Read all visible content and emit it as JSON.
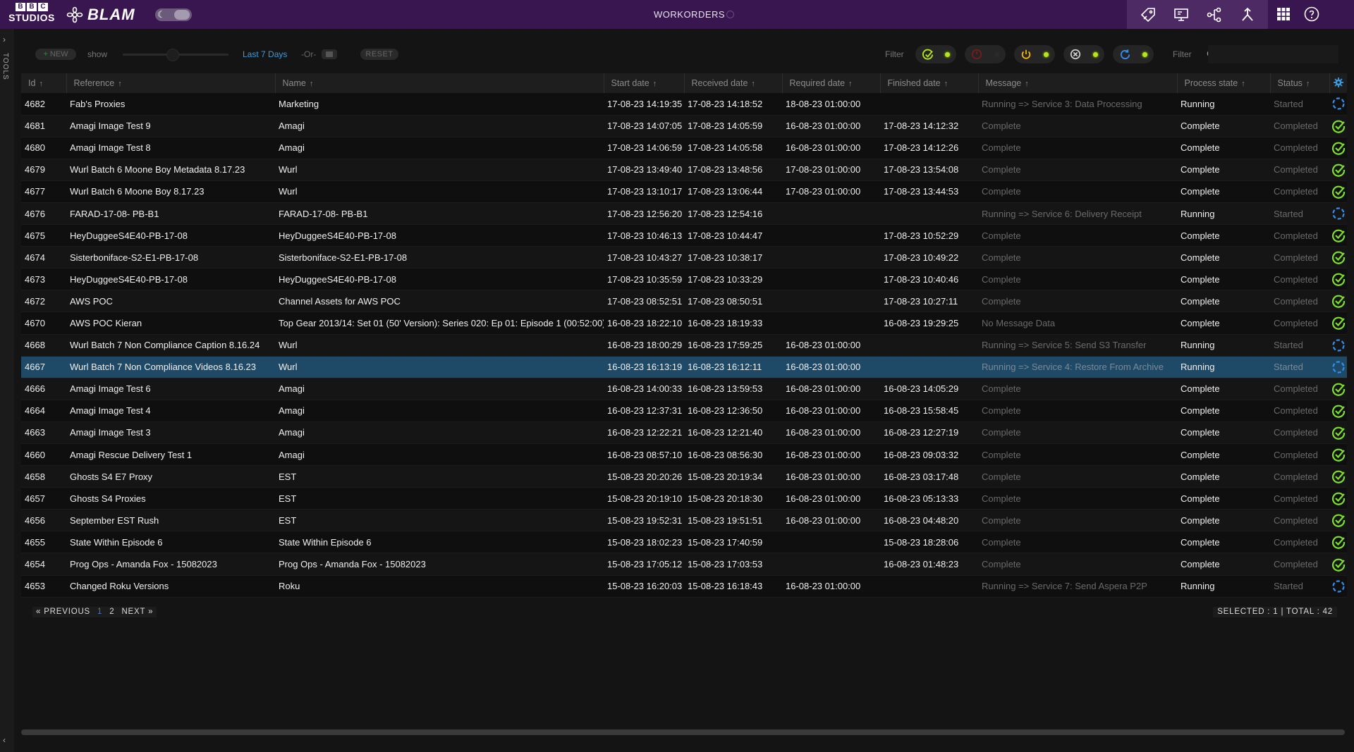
{
  "app": {
    "logo_top": [
      "B",
      "B",
      "C"
    ],
    "logo_bottom": "STUDIOS",
    "brand": "BLAM",
    "title": "WORKORDERS"
  },
  "tools": {
    "label": "TOOLS"
  },
  "filterbar": {
    "new_label": "NEW",
    "show_label": "show",
    "range_label": "Last 7 Days",
    "or_label": "-Or-",
    "reset_label": "RESET",
    "filter_label": "Filter",
    "search_label": "Filter",
    "search_value": "",
    "pills": [
      {
        "icon": "check-circle-icon",
        "color": "#b5e61d",
        "active": true
      },
      {
        "icon": "stop-circle-icon",
        "color": "#7a1b1b",
        "active": false
      },
      {
        "icon": "power-icon",
        "color": "#f5b800",
        "active": true
      },
      {
        "icon": "cancel-circle-icon",
        "color": "#cfcfcf",
        "active": true
      },
      {
        "icon": "refresh-icon",
        "color": "#2f8ff0",
        "active": true
      }
    ]
  },
  "table": {
    "columns": [
      {
        "label": "Id",
        "arrow": "↑"
      },
      {
        "label": "Reference",
        "arrow": "↑"
      },
      {
        "label": "Name",
        "arrow": "↑"
      },
      {
        "label": "Start date",
        "arrow": "↑"
      },
      {
        "label": "Received date",
        "arrow": "↑"
      },
      {
        "label": "Required date",
        "arrow": "↑"
      },
      {
        "label": "Finished date",
        "arrow": "↑"
      },
      {
        "label": "Message",
        "arrow": "↑"
      },
      {
        "label": "Process state",
        "arrow": "↑"
      },
      {
        "label": "Status",
        "arrow": "↑"
      }
    ],
    "rows": [
      {
        "id": "4682",
        "reference": "Fab's Proxies",
        "name": "Marketing",
        "start": "17-08-23 14:19:35",
        "received": "17-08-23 14:18:52",
        "required": "18-08-23 01:00:00",
        "finished": "",
        "message": "Running => Service 3: Data Processing",
        "process": "Running",
        "status": "Started",
        "icon": "spinner-icon"
      },
      {
        "id": "4681",
        "reference": "Amagi Image Test 9",
        "name": "Amagi",
        "start": "17-08-23 14:07:05",
        "received": "17-08-23 14:05:59",
        "required": "16-08-23 01:00:00",
        "finished": "17-08-23 14:12:32",
        "message": "Complete",
        "process": "Complete",
        "status": "Completed",
        "icon": "check-icon"
      },
      {
        "id": "4680",
        "reference": "Amagi Image Test 8",
        "name": "Amagi",
        "start": "17-08-23 14:06:59",
        "received": "17-08-23 14:05:58",
        "required": "16-08-23 01:00:00",
        "finished": "17-08-23 14:12:26",
        "message": "Complete",
        "process": "Complete",
        "status": "Completed",
        "icon": "check-icon"
      },
      {
        "id": "4679",
        "reference": "Wurl Batch 6 Moone Boy Metadata 8.17.23",
        "name": "Wurl",
        "start": "17-08-23 13:49:40",
        "received": "17-08-23 13:48:56",
        "required": "17-08-23 01:00:00",
        "finished": "17-08-23 13:54:08",
        "message": "Complete",
        "process": "Complete",
        "status": "Completed",
        "icon": "check-icon"
      },
      {
        "id": "4677",
        "reference": "Wurl Batch 6 Moone Boy 8.17.23",
        "name": "Wurl",
        "start": "17-08-23 13:10:17",
        "received": "17-08-23 13:06:44",
        "required": "17-08-23 01:00:00",
        "finished": "17-08-23 13:44:53",
        "message": "Complete",
        "process": "Complete",
        "status": "Completed",
        "icon": "check-icon"
      },
      {
        "id": "4676",
        "reference": "FARAD-17-08- PB-B1",
        "name": "FARAD-17-08- PB-B1",
        "start": "17-08-23 12:56:20",
        "received": "17-08-23 12:54:16",
        "required": "",
        "finished": "",
        "message": "Running => Service 6: Delivery Receipt",
        "process": "Running",
        "status": "Started",
        "icon": "spinner-icon"
      },
      {
        "id": "4675",
        "reference": "HeyDuggeeS4E40-PB-17-08",
        "name": "HeyDuggeeS4E40-PB-17-08",
        "start": "17-08-23 10:46:13",
        "received": "17-08-23 10:44:47",
        "required": "",
        "finished": "17-08-23 10:52:29",
        "message": "Complete",
        "process": "Complete",
        "status": "Completed",
        "icon": "check-icon"
      },
      {
        "id": "4674",
        "reference": "Sisterboniface-S2-E1-PB-17-08",
        "name": "Sisterboniface-S2-E1-PB-17-08",
        "start": "17-08-23 10:43:27",
        "received": "17-08-23 10:38:17",
        "required": "",
        "finished": "17-08-23 10:49:22",
        "message": "Complete",
        "process": "Complete",
        "status": "Completed",
        "icon": "check-icon"
      },
      {
        "id": "4673",
        "reference": "HeyDuggeeS4E40-PB-17-08",
        "name": "HeyDuggeeS4E40-PB-17-08",
        "start": "17-08-23 10:35:59",
        "received": "17-08-23 10:33:29",
        "required": "",
        "finished": "17-08-23 10:40:46",
        "message": "Complete",
        "process": "Complete",
        "status": "Completed",
        "icon": "check-icon"
      },
      {
        "id": "4672",
        "reference": " AWS POC",
        "name": "Channel Assets for AWS POC",
        "start": "17-08-23 08:52:51",
        "received": "17-08-23 08:50:51",
        "required": "",
        "finished": "17-08-23 10:27:11",
        "message": "Complete",
        "process": "Complete",
        "status": "Completed",
        "icon": "check-icon"
      },
      {
        "id": "4670",
        "reference": "AWS POC Kieran",
        "name": "Top Gear 2013/14: Set 01 (50' Version): Series 020: Ep 01: Episode 1 (00:52:00)",
        "start": "16-08-23 18:22:10",
        "received": "16-08-23 18:19:33",
        "required": "",
        "finished": "16-08-23 19:29:25",
        "message": "No Message Data",
        "process": "Complete",
        "status": "Completed",
        "icon": "check-icon"
      },
      {
        "id": "4668",
        "reference": "Wurl Batch 7  Non Compliance Caption 8.16.24",
        "name": "Wurl",
        "start": "16-08-23 18:00:29",
        "received": "16-08-23 17:59:25",
        "required": "16-08-23 01:00:00",
        "finished": "",
        "message": "Running => Service 5: Send S3 Transfer",
        "process": "Running",
        "status": "Started",
        "icon": "spinner-icon"
      },
      {
        "id": "4667",
        "reference": "Wurl Batch 7  Non Compliance Videos 8.16.23",
        "name": "Wurl",
        "start": "16-08-23 16:13:19",
        "received": "16-08-23 16:12:11",
        "required": "16-08-23 01:00:00",
        "finished": "",
        "message": "Running => Service 4: Restore From Archive",
        "process": "Running",
        "status": "Started",
        "icon": "spinner-icon",
        "selected": true
      },
      {
        "id": "4666",
        "reference": "Amagi Image Test 6",
        "name": "Amagi",
        "start": "16-08-23 14:00:33",
        "received": "16-08-23 13:59:53",
        "required": "16-08-23 01:00:00",
        "finished": "16-08-23 14:05:29",
        "message": "Complete",
        "process": "Complete",
        "status": "Completed",
        "icon": "check-icon"
      },
      {
        "id": "4664",
        "reference": "Amagi Image Test 4",
        "name": "Amagi",
        "start": "16-08-23 12:37:31",
        "received": "16-08-23 12:36:50",
        "required": "16-08-23 01:00:00",
        "finished": "16-08-23 15:58:45",
        "message": "Complete",
        "process": "Complete",
        "status": "Completed",
        "icon": "check-icon"
      },
      {
        "id": "4663",
        "reference": "Amagi Image Test 3",
        "name": "Amagi",
        "start": "16-08-23 12:22:21",
        "received": "16-08-23 12:21:40",
        "required": "16-08-23 01:00:00",
        "finished": "16-08-23 12:27:19",
        "message": "Complete",
        "process": "Complete",
        "status": "Completed",
        "icon": "check-icon"
      },
      {
        "id": "4660",
        "reference": "Amagi Rescue Delivery Test 1",
        "name": "Amagi",
        "start": "16-08-23 08:57:10",
        "received": "16-08-23 08:56:30",
        "required": "16-08-23 01:00:00",
        "finished": "16-08-23 09:03:32",
        "message": "Complete",
        "process": "Complete",
        "status": "Completed",
        "icon": "check-icon"
      },
      {
        "id": "4658",
        "reference": "Ghosts S4 E7 Proxy",
        "name": "EST",
        "start": "15-08-23 20:20:26",
        "received": "15-08-23 20:19:34",
        "required": "16-08-23 01:00:00",
        "finished": "16-08-23 03:17:48",
        "message": "Complete",
        "process": "Complete",
        "status": "Completed",
        "icon": "check-icon"
      },
      {
        "id": "4657",
        "reference": "Ghosts S4 Proxies",
        "name": "EST",
        "start": "15-08-23 20:19:10",
        "received": "15-08-23 20:18:30",
        "required": "16-08-23 01:00:00",
        "finished": "16-08-23 05:13:33",
        "message": "Complete",
        "process": "Complete",
        "status": "Completed",
        "icon": "check-icon"
      },
      {
        "id": "4656",
        "reference": "September EST Rush",
        "name": "EST",
        "start": "15-08-23 19:52:31",
        "received": "15-08-23 19:51:51",
        "required": "16-08-23 01:00:00",
        "finished": "16-08-23 04:48:20",
        "message": "Complete",
        "process": "Complete",
        "status": "Completed",
        "icon": "check-icon"
      },
      {
        "id": "4655",
        "reference": "State Within Episode 6",
        "name": "State Within Episode 6",
        "start": "15-08-23 18:02:23",
        "received": "15-08-23 17:40:59",
        "required": "",
        "finished": "15-08-23 18:28:06",
        "message": "Complete",
        "process": "Complete",
        "status": "Completed",
        "icon": "check-icon"
      },
      {
        "id": "4654",
        "reference": "Prog Ops - Amanda Fox - 15082023",
        "name": "Prog Ops - Amanda Fox - 15082023",
        "start": "15-08-23 17:05:12",
        "received": "15-08-23 17:03:53",
        "required": "",
        "finished": "16-08-23 01:48:23",
        "message": "Complete",
        "process": "Complete",
        "status": "Completed",
        "icon": "check-icon"
      },
      {
        "id": "4653",
        "reference": "Changed Roku Versions",
        "name": "Roku",
        "start": "15-08-23 16:20:03",
        "received": "15-08-23 16:18:43",
        "required": "16-08-23 01:00:00",
        "finished": "",
        "message": "Running => Service 7: Send Aspera P2P",
        "process": "Running",
        "status": "Started",
        "icon": "spinner-icon"
      }
    ]
  },
  "pagination": {
    "previous_label": "« PREVIOUS",
    "pages": [
      "1",
      "2"
    ],
    "current_page": "1",
    "next_label": "NEXT »",
    "summary": "SELECTED : 1 | TOTAL : 42"
  }
}
